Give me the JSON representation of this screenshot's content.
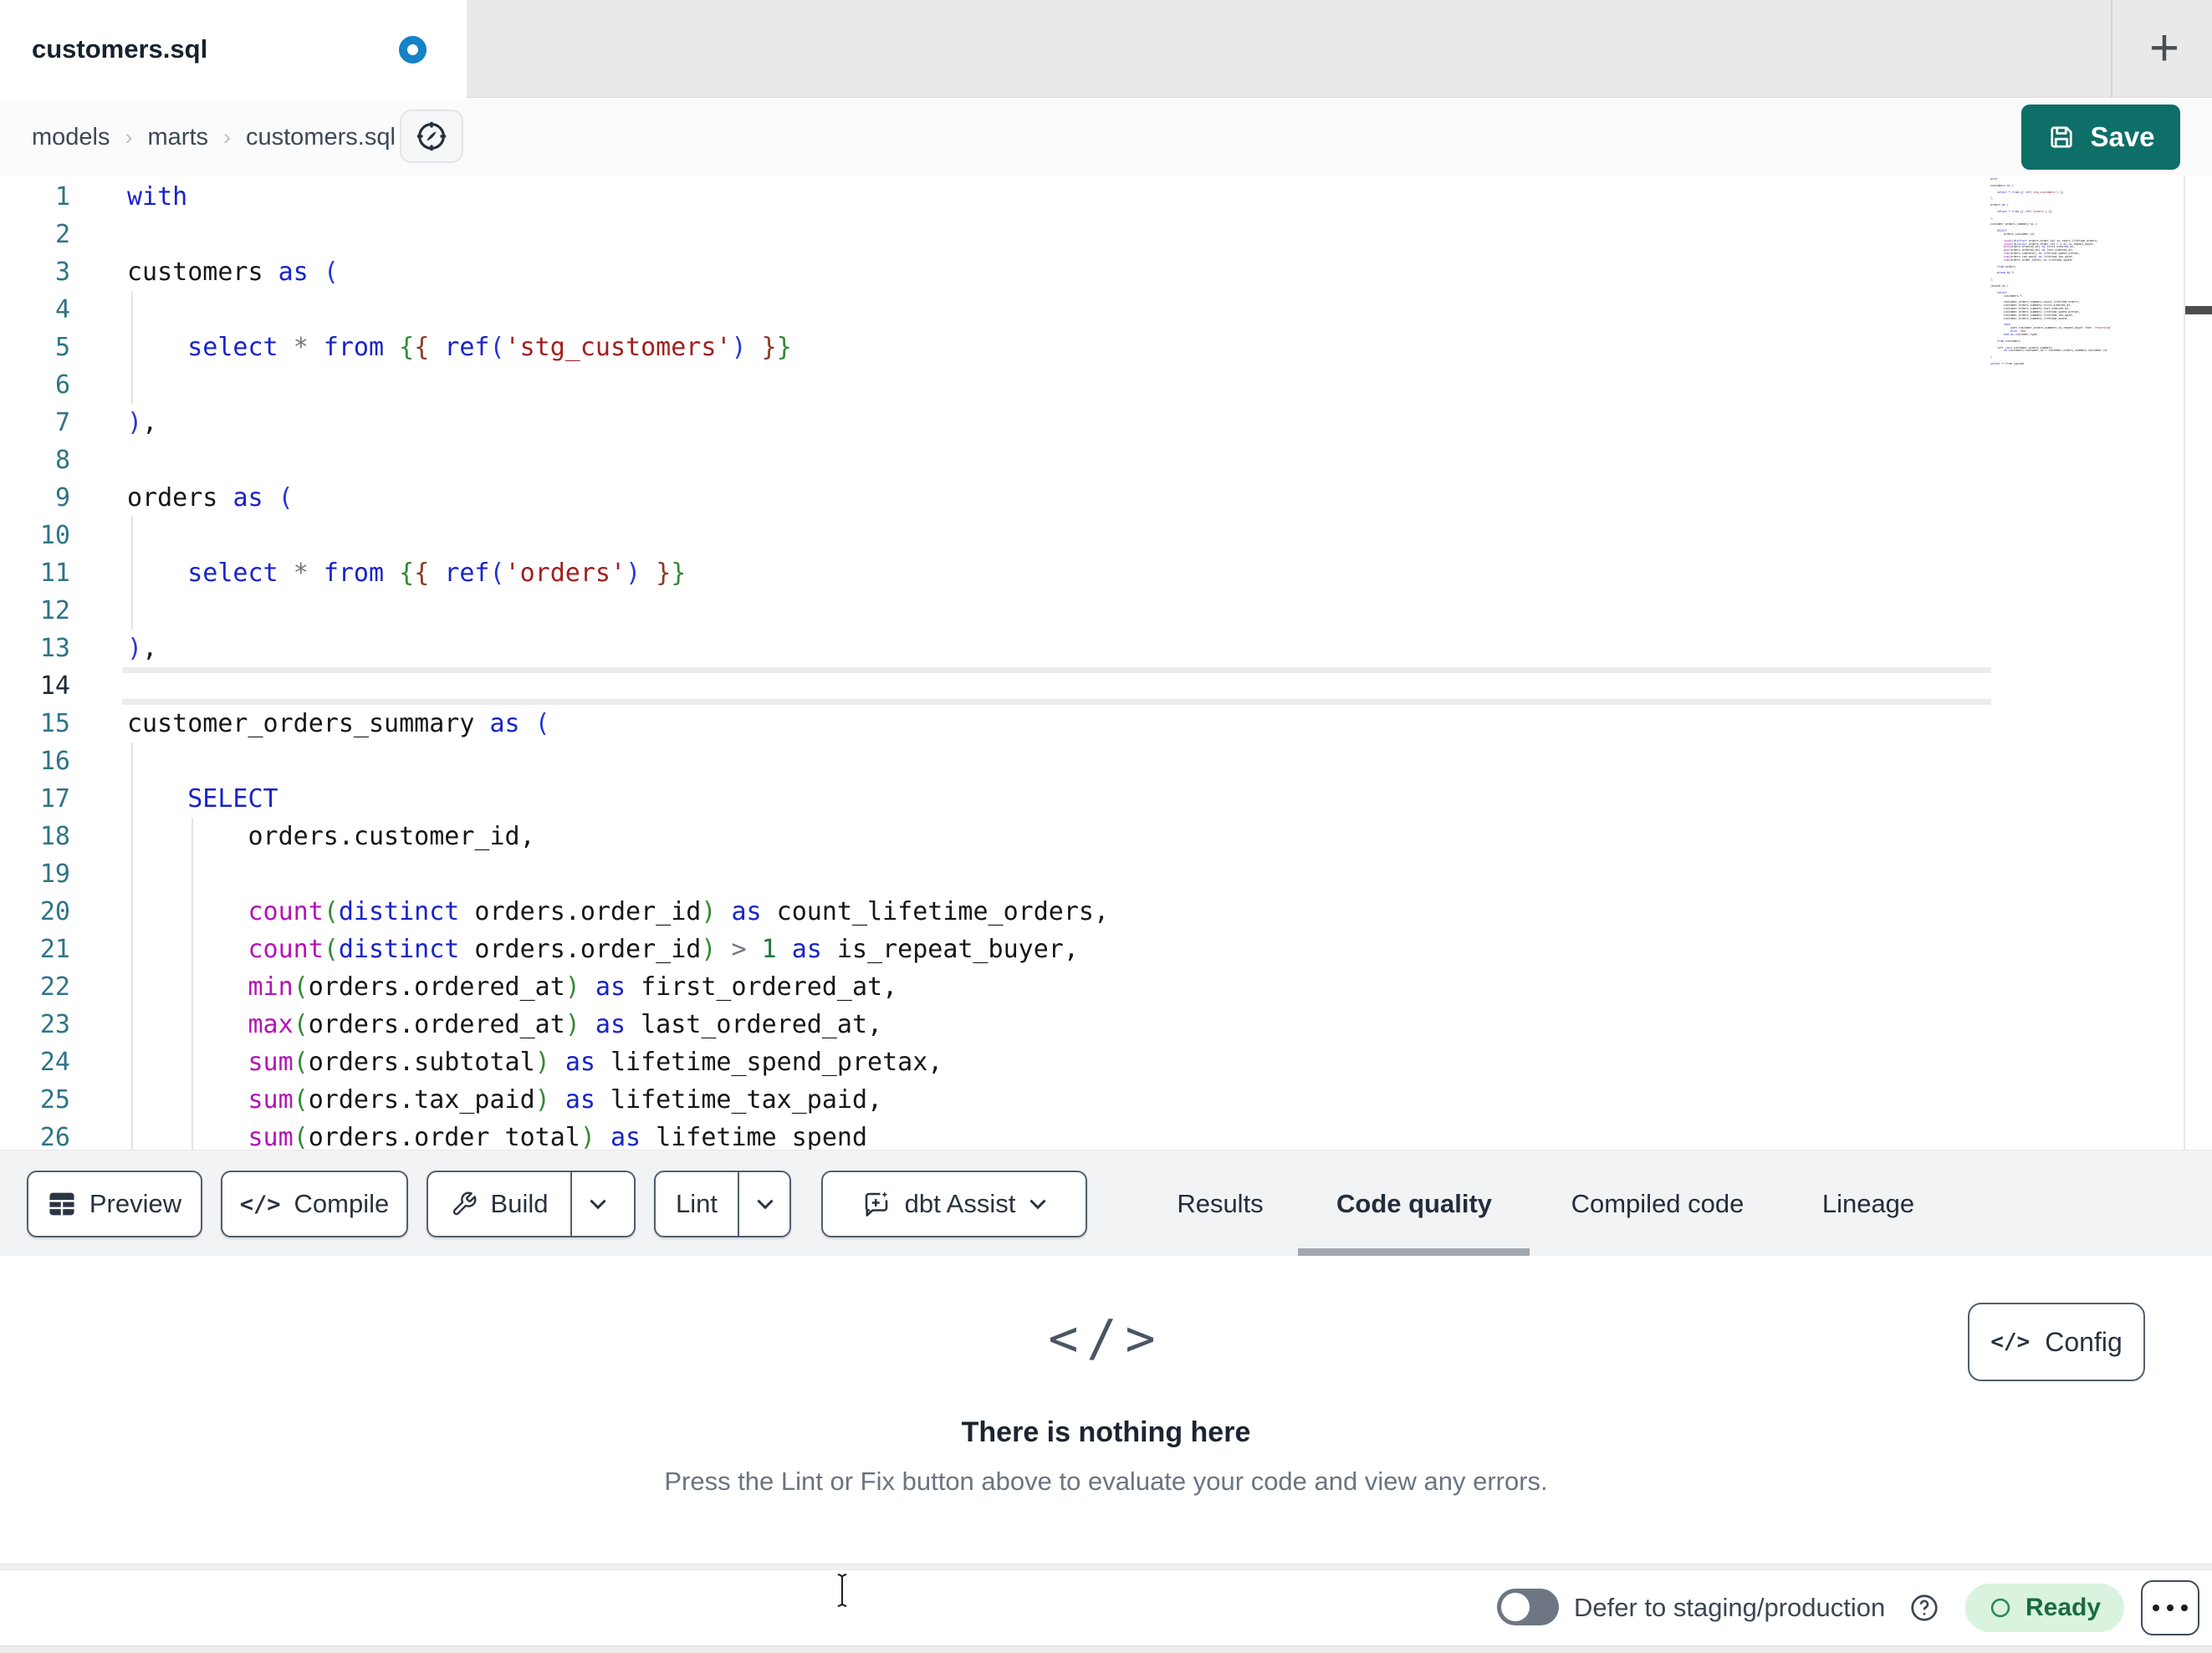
{
  "colors": {
    "accent_teal": "#0e6e68",
    "unsaved_dot_blue": "#1583c7",
    "ready_green_bg": "#d9f3de",
    "ready_green_text": "#1a6b40",
    "keyword_blue": "#1824c9",
    "function_magenta": "#b612b6",
    "string_red": "#a02020"
  },
  "tab_bar": {
    "tab_title": "customers.sql",
    "new_tab_label": "+"
  },
  "breadcrumb": {
    "items": [
      "models",
      "marts",
      "customers.sql"
    ],
    "separator": "›"
  },
  "save": {
    "label": "Save"
  },
  "toolbar": {
    "preview_label": "Preview",
    "compile_label": "Compile",
    "compile_icon": "</>",
    "build_label": "Build",
    "lint_label": "Lint",
    "assist_label": "dbt Assist"
  },
  "panel_tabs": [
    {
      "label": "Results",
      "active": false
    },
    {
      "label": "Code quality",
      "active": true
    },
    {
      "label": "Compiled code",
      "active": false
    },
    {
      "label": "Lineage",
      "active": false
    }
  ],
  "panel": {
    "config_label": "Config",
    "config_icon": "</>",
    "empty_icon": "</>",
    "empty_title": "There is nothing here",
    "empty_subtitle": "Press the Lint or Fix button above to evaluate your code and view any errors."
  },
  "status_bar": {
    "defer_label": "Defer to staging/production",
    "ready_label": "Ready",
    "toggle_on": false
  },
  "editor": {
    "active_line": 14,
    "lines": [
      {
        "n": 1,
        "t": [
          [
            "kw",
            "with"
          ]
        ]
      },
      {
        "n": 2,
        "t": []
      },
      {
        "n": 3,
        "t": [
          [
            "pl",
            "customers "
          ],
          [
            "kw",
            "as"
          ],
          [
            "pl",
            " "
          ],
          [
            "b1",
            "("
          ]
        ]
      },
      {
        "n": 4,
        "t": []
      },
      {
        "n": 5,
        "t": [
          [
            "pl",
            "    "
          ],
          [
            "kw",
            "select"
          ],
          [
            "pl",
            " "
          ],
          [
            "op",
            "*"
          ],
          [
            "pl",
            " "
          ],
          [
            "kw",
            "from"
          ],
          [
            "pl",
            " "
          ],
          [
            "b2",
            "{"
          ],
          [
            "b3",
            "{"
          ],
          [
            "pl",
            " "
          ],
          [
            "kw",
            "ref"
          ],
          [
            "b1",
            "("
          ],
          [
            "str",
            "'stg_customers'"
          ],
          [
            "b1",
            ")"
          ],
          [
            "pl",
            " "
          ],
          [
            "b3",
            "}"
          ],
          [
            "b2",
            "}"
          ]
        ]
      },
      {
        "n": 6,
        "t": []
      },
      {
        "n": 7,
        "t": [
          [
            "b1",
            ")"
          ],
          [
            "pl",
            ","
          ]
        ]
      },
      {
        "n": 8,
        "t": []
      },
      {
        "n": 9,
        "t": [
          [
            "pl",
            "orders "
          ],
          [
            "kw",
            "as"
          ],
          [
            "pl",
            " "
          ],
          [
            "b1",
            "("
          ]
        ]
      },
      {
        "n": 10,
        "t": []
      },
      {
        "n": 11,
        "t": [
          [
            "pl",
            "    "
          ],
          [
            "kw",
            "select"
          ],
          [
            "pl",
            " "
          ],
          [
            "op",
            "*"
          ],
          [
            "pl",
            " "
          ],
          [
            "kw",
            "from"
          ],
          [
            "pl",
            " "
          ],
          [
            "b2",
            "{"
          ],
          [
            "b3",
            "{"
          ],
          [
            "pl",
            " "
          ],
          [
            "kw",
            "ref"
          ],
          [
            "b1",
            "("
          ],
          [
            "str",
            "'orders'"
          ],
          [
            "b1",
            ")"
          ],
          [
            "pl",
            " "
          ],
          [
            "b3",
            "}"
          ],
          [
            "b2",
            "}"
          ]
        ]
      },
      {
        "n": 12,
        "t": []
      },
      {
        "n": 13,
        "t": [
          [
            "b1",
            ")"
          ],
          [
            "pl",
            ","
          ]
        ]
      },
      {
        "n": 14,
        "t": []
      },
      {
        "n": 15,
        "t": [
          [
            "pl",
            "customer_orders_summary "
          ],
          [
            "kw",
            "as"
          ],
          [
            "pl",
            " "
          ],
          [
            "b1",
            "("
          ]
        ]
      },
      {
        "n": 16,
        "t": []
      },
      {
        "n": 17,
        "t": [
          [
            "pl",
            "    "
          ],
          [
            "kw",
            "SELECT"
          ]
        ]
      },
      {
        "n": 18,
        "t": [
          [
            "pl",
            "        orders.customer_id,"
          ]
        ]
      },
      {
        "n": 19,
        "t": []
      },
      {
        "n": 20,
        "t": [
          [
            "pl",
            "        "
          ],
          [
            "fn",
            "count"
          ],
          [
            "b2",
            "("
          ],
          [
            "kw",
            "distinct"
          ],
          [
            "pl",
            " orders.order_id"
          ],
          [
            "b2",
            ")"
          ],
          [
            "pl",
            " "
          ],
          [
            "kw",
            "as"
          ],
          [
            "pl",
            " count_lifetime_orders,"
          ]
        ]
      },
      {
        "n": 21,
        "t": [
          [
            "pl",
            "        "
          ],
          [
            "fn",
            "count"
          ],
          [
            "b2",
            "("
          ],
          [
            "kw",
            "distinct"
          ],
          [
            "pl",
            " orders.order_id"
          ],
          [
            "b2",
            ")"
          ],
          [
            "pl",
            " "
          ],
          [
            "op",
            ">"
          ],
          [
            "pl",
            " "
          ],
          [
            "num",
            "1"
          ],
          [
            "pl",
            " "
          ],
          [
            "kw",
            "as"
          ],
          [
            "pl",
            " is_repeat_buyer,"
          ]
        ]
      },
      {
        "n": 22,
        "t": [
          [
            "pl",
            "        "
          ],
          [
            "fn",
            "min"
          ],
          [
            "b2",
            "("
          ],
          [
            "pl",
            "orders.ordered_at"
          ],
          [
            "b2",
            ")"
          ],
          [
            "pl",
            " "
          ],
          [
            "kw",
            "as"
          ],
          [
            "pl",
            " first_ordered_at,"
          ]
        ]
      },
      {
        "n": 23,
        "t": [
          [
            "pl",
            "        "
          ],
          [
            "fn",
            "max"
          ],
          [
            "b2",
            "("
          ],
          [
            "pl",
            "orders.ordered_at"
          ],
          [
            "b2",
            ")"
          ],
          [
            "pl",
            " "
          ],
          [
            "kw",
            "as"
          ],
          [
            "pl",
            " last_ordered_at,"
          ]
        ]
      },
      {
        "n": 24,
        "t": [
          [
            "pl",
            "        "
          ],
          [
            "fn",
            "sum"
          ],
          [
            "b2",
            "("
          ],
          [
            "pl",
            "orders.subtotal"
          ],
          [
            "b2",
            ")"
          ],
          [
            "pl",
            " "
          ],
          [
            "kw",
            "as"
          ],
          [
            "pl",
            " lifetime_spend_pretax,"
          ]
        ]
      },
      {
        "n": 25,
        "t": [
          [
            "pl",
            "        "
          ],
          [
            "fn",
            "sum"
          ],
          [
            "b2",
            "("
          ],
          [
            "pl",
            "orders.tax_paid"
          ],
          [
            "b2",
            ")"
          ],
          [
            "pl",
            " "
          ],
          [
            "kw",
            "as"
          ],
          [
            "pl",
            " lifetime_tax_paid,"
          ]
        ]
      },
      {
        "n": 26,
        "t": [
          [
            "pl",
            "        "
          ],
          [
            "fn",
            "sum"
          ],
          [
            "b2",
            "("
          ],
          [
            "pl",
            "orders.order_total"
          ],
          [
            "b2",
            ")"
          ],
          [
            "pl",
            " "
          ],
          [
            "kw",
            "as"
          ],
          [
            "pl",
            " lifetime_spend"
          ]
        ]
      }
    ]
  },
  "minimap": {
    "lines": [
      "with",
      "",
      "customers as (",
      "",
      "    select * from {{ ref('stg_customers') }}",
      "",
      "),",
      "",
      "orders as (",
      "",
      "    select * from {{ ref('orders') }}",
      "",
      "),",
      "",
      "customer_orders_summary as (",
      "",
      "    SELECT",
      "        orders.customer_id,",
      "",
      "        count(distinct orders.order_id) as count_lifetime_orders,",
      "        count(distinct orders.order_id) > 1 as is_repeat_buyer,",
      "        min(orders.ordered_at) as first_ordered_at,",
      "        max(orders.ordered_at) as last_ordered_at,",
      "        sum(orders.subtotal) as lifetime_spend_pretax,",
      "        sum(orders.tax_paid) as lifetime_tax_paid,",
      "        sum(orders.order_total) as lifetime_spend",
      "",
      "    from orders",
      "",
      "    group by 1",
      "",
      "),",
      "",
      "joined as (",
      "",
      "    select",
      "        customers.*,",
      "",
      "        customer_orders_summary.count_lifetime_orders,",
      "        customer_orders_summary.first_ordered_at,",
      "        customer_orders_summary.last_ordered_at,",
      "        customer_orders_summary.lifetime_spend_pretax,",
      "        customer_orders_summary.lifetime_tax_paid,",
      "        customer_orders_summary.lifetime_spend,",
      "",
      "        case",
      "            when customer_orders_summary.is_repeat_buyer then 'returning'",
      "            else 'new'",
      "        end as customer_type",
      "",
      "    from customers",
      "",
      "    left join customer_orders_summary",
      "        on customers.customer_id = customer_orders_summary.customer_id",
      "",
      ")",
      "",
      "select * from joined"
    ]
  }
}
